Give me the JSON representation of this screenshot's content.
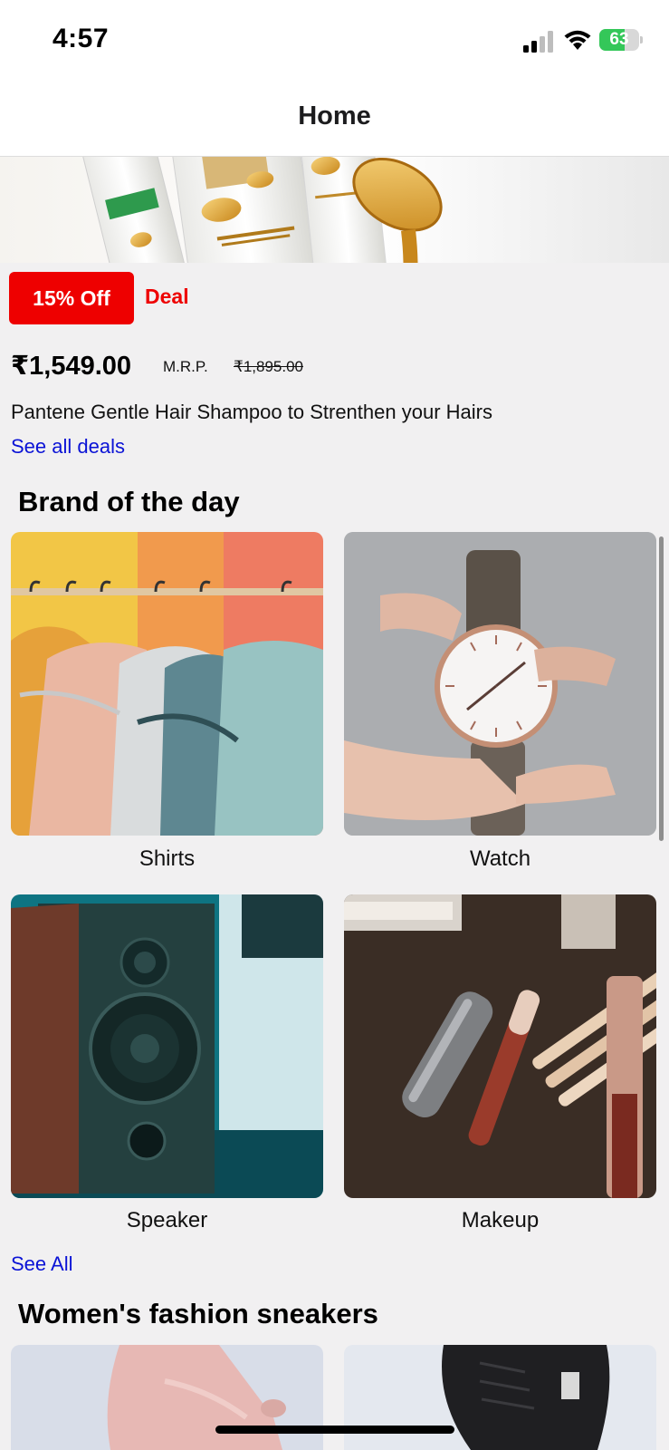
{
  "status_bar": {
    "time": "4:57",
    "battery_level": "63",
    "battery_fraction": 0.63,
    "icons": [
      "cellular-signal-icon",
      "wifi-icon",
      "battery-icon"
    ]
  },
  "nav": {
    "title": "Home"
  },
  "deal": {
    "banner_image": "pantene-shampoo-banner",
    "badge": "15% Off",
    "label": "Deal",
    "price": "₹1,549.00",
    "mrp_label": "M.R.P.",
    "mrp_value": "₹1,895.00",
    "title": "Pantene Gentle Hair Shampoo to Strenthen your Hairs",
    "see_all": "See all deals"
  },
  "brand_of_day": {
    "heading": "Brand of the day",
    "items": [
      {
        "label": "Shirts",
        "image": "shirts-on-rack-photo"
      },
      {
        "label": "Watch",
        "image": "wrist-watch-photo"
      },
      {
        "label": "Speaker",
        "image": "speaker-photo"
      },
      {
        "label": "Makeup",
        "image": "makeup-brushes-photo"
      }
    ],
    "see_all": "See All"
  },
  "sneakers": {
    "heading": "Women's fashion sneakers",
    "items": [
      {
        "image": "pink-sneaker-photo"
      },
      {
        "image": "black-sneaker-photo"
      }
    ]
  },
  "colors": {
    "accent_red": "#ee0000",
    "link_blue": "#0b13d6",
    "battery_green": "#34c759",
    "background": "#f1f0f1"
  }
}
